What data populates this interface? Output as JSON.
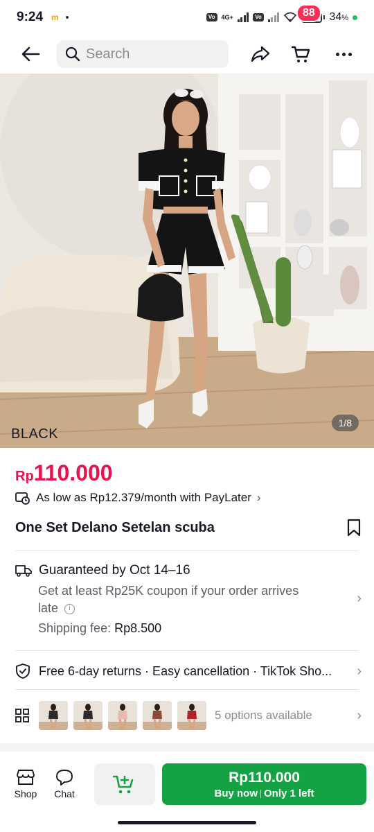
{
  "status_bar": {
    "time": "9:24",
    "carrier_icon": "m",
    "network": "4G+",
    "battery_percent": "34",
    "battery_suffix": "%",
    "battery_level": 0.34
  },
  "header": {
    "search_placeholder": "Search",
    "cart_count": "88"
  },
  "gallery": {
    "variant_label": "BLACK",
    "counter": "1/8"
  },
  "price": {
    "currency": "Rp",
    "amount": "110.000"
  },
  "paylater": {
    "text": "As low as Rp12.379/month with PayLater"
  },
  "product": {
    "title": "One Set Delano Setelan scuba"
  },
  "shipping": {
    "guarantee": "Guaranteed by Oct 14–16",
    "coupon_line1": "Get at least Rp25K coupon if your order arrives",
    "coupon_line2": "late",
    "fee_label": "Shipping fee:",
    "fee_value": "Rp8.500"
  },
  "returns": {
    "text": "Free 6-day returns · Easy cancellation · TikTok Sho..."
  },
  "options": {
    "text": "5 options available",
    "thumb_colors": [
      "#2b2b2b",
      "#2b2b2b",
      "#e7b9b0",
      "#8c4a3b",
      "#b0212a"
    ]
  },
  "bottom": {
    "shop_label": "Shop",
    "chat_label": "Chat",
    "buy_price": "Rp110.000",
    "buy_label": "Buy now",
    "stock_label": "Only 1 left"
  },
  "colors": {
    "accent_red": "#e8124e",
    "badge_red": "#fe2c55",
    "buy_green": "#15a245"
  }
}
